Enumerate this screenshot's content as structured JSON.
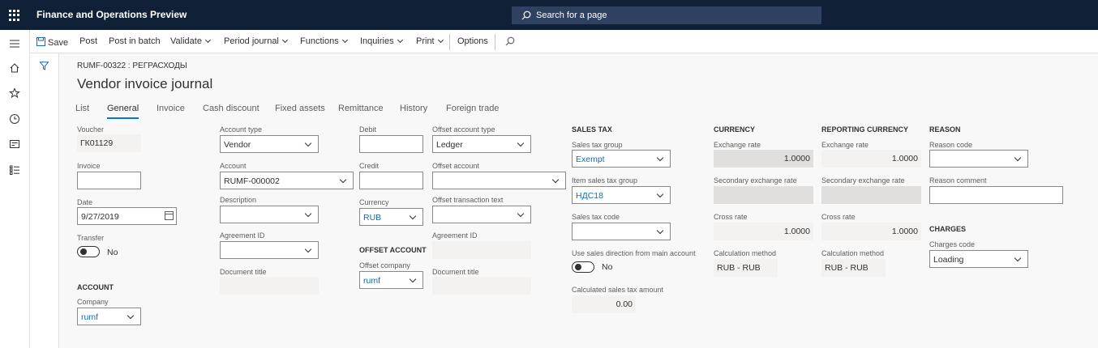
{
  "app": {
    "title": "Finance and Operations Preview",
    "search_placeholder": "Search for a page"
  },
  "actions": {
    "save": "Save",
    "post": "Post",
    "post_in_batch": "Post in batch",
    "validate": "Validate",
    "period_journal": "Period journal",
    "functions": "Functions",
    "inquiries": "Inquiries",
    "print": "Print",
    "options": "Options"
  },
  "page": {
    "breadcrumb": "RUMF-00322 : РЕГРАСХОДЫ",
    "title": "Vendor invoice journal"
  },
  "tabs": [
    "List",
    "General",
    "Invoice",
    "Cash discount",
    "Fixed assets",
    "Remittance",
    "History",
    "Foreign trade"
  ],
  "active_tab": "General",
  "col1": {
    "voucher_label": "Voucher",
    "voucher": "ГК01129",
    "invoice_label": "Invoice",
    "invoice": "",
    "date_label": "Date",
    "date": "9/27/2019",
    "transfer_label": "Transfer",
    "transfer": "No",
    "account_header": "ACCOUNT",
    "company_label": "Company",
    "company": "rumf"
  },
  "col2": {
    "account_type_label": "Account type",
    "account_type": "Vendor",
    "account_label": "Account",
    "account": "RUMF-000002",
    "description_label": "Description",
    "description": "",
    "agreement_id_label": "Agreement ID",
    "agreement_id": "",
    "document_title_label": "Document title",
    "document_title": ""
  },
  "col3": {
    "debit_label": "Debit",
    "debit": "",
    "credit_label": "Credit",
    "credit": "",
    "currency_label": "Currency",
    "currency": "RUB",
    "offset_account_header": "OFFSET ACCOUNT",
    "offset_company_label": "Offset company",
    "offset_company": "rumf"
  },
  "col4": {
    "offset_account_type_label": "Offset account type",
    "offset_account_type": "Ledger",
    "offset_account_label": "Offset account",
    "offset_account": "",
    "offset_transaction_text_label": "Offset transaction text",
    "offset_transaction_text": "",
    "agreement_id_label": "Agreement ID",
    "agreement_id": "",
    "document_title_label": "Document title",
    "document_title": ""
  },
  "sales_tax": {
    "header": "SALES TAX",
    "group_label": "Sales tax group",
    "group": "Exempt",
    "item_group_label": "Item sales tax group",
    "item_group": "НДС18",
    "code_label": "Sales tax code",
    "code": "",
    "use_direction_label": "Use sales direction from main account",
    "use_direction": "No",
    "calculated_label": "Calculated sales tax amount",
    "calculated": "0.00"
  },
  "currency": {
    "header": "CURRENCY",
    "exchange_rate_label": "Exchange rate",
    "exchange_rate": "1.0000",
    "secondary_label": "Secondary exchange rate",
    "secondary": "",
    "cross_rate_label": "Cross rate",
    "cross_rate": "1.0000",
    "calc_method_label": "Calculation method",
    "calc_method": "RUB - RUB"
  },
  "reporting_currency": {
    "header": "REPORTING CURRENCY",
    "exchange_rate_label": "Exchange rate",
    "exchange_rate": "1.0000",
    "secondary_label": "Secondary exchange rate",
    "secondary": "",
    "cross_rate_label": "Cross rate",
    "cross_rate": "1.0000",
    "calc_method_label": "Calculation method",
    "calc_method": "RUB - RUB"
  },
  "reason": {
    "header": "REASON",
    "code_label": "Reason code",
    "code": "",
    "comment_label": "Reason comment",
    "comment": ""
  },
  "charges": {
    "header": "CHARGES",
    "code_label": "Charges code",
    "code": "Loading"
  },
  "colors": {
    "topbar": "#0f2037",
    "accent": "#0078d4",
    "link": "#0f6cbd"
  }
}
